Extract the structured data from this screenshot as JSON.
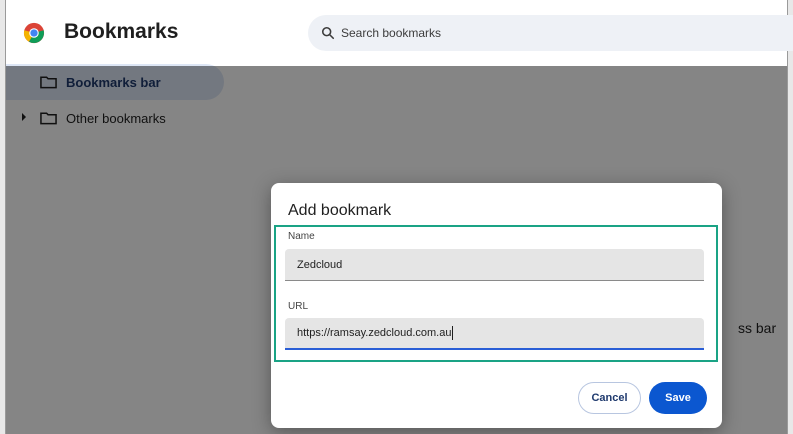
{
  "app": {
    "title": "Bookmarks",
    "search_placeholder": "Search bookmarks"
  },
  "sidebar": {
    "items": [
      {
        "label": "Bookmarks bar",
        "icon": "folder-icon",
        "active": true
      },
      {
        "label": "Other bookmarks",
        "icon": "folder-icon",
        "active": false,
        "expandable": true
      }
    ]
  },
  "background": {
    "partial_text": "ss bar"
  },
  "dialog": {
    "title": "Add bookmark",
    "name_label": "Name",
    "name_value": "Zedcloud",
    "url_label": "URL",
    "url_value": "https://ramsay.zedcloud.com.au",
    "cancel_label": "Cancel",
    "save_label": "Save"
  },
  "colors": {
    "accent": "#0b57d0",
    "highlight": "#1aa385",
    "sidebar_active": "#dde6f5",
    "search_bg": "#eef1f6"
  }
}
